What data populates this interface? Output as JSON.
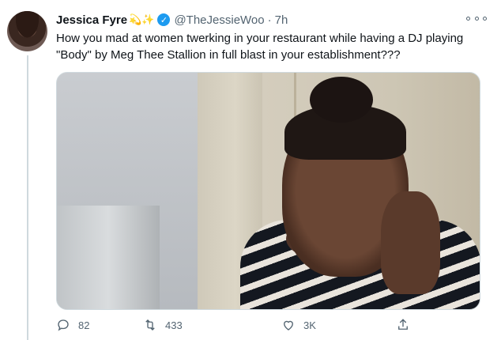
{
  "tweet": {
    "author_name": "Jessica Fyre",
    "author_emojis": "💫✨",
    "verified_mark": "✓",
    "handle": "@TheJessieWoo",
    "separator": "·",
    "timestamp": "7h",
    "text": "How you mad at women twerking in your restaurant while having a DJ playing \"Body\" by Meg Thee Stallion in full blast in your establishment???"
  },
  "actions": {
    "reply_count": "82",
    "retweet_count": "433",
    "like_count": "3K"
  },
  "icons": {
    "reply": "comment-icon",
    "retweet": "retweet-icon",
    "like": "heart-icon",
    "share": "share-icon",
    "more": "more-options-icon",
    "verified": "verified-badge-icon"
  },
  "colors": {
    "verified_blue": "#1d9bf0",
    "secondary_text": "#536471",
    "primary_text": "#0f1419"
  }
}
